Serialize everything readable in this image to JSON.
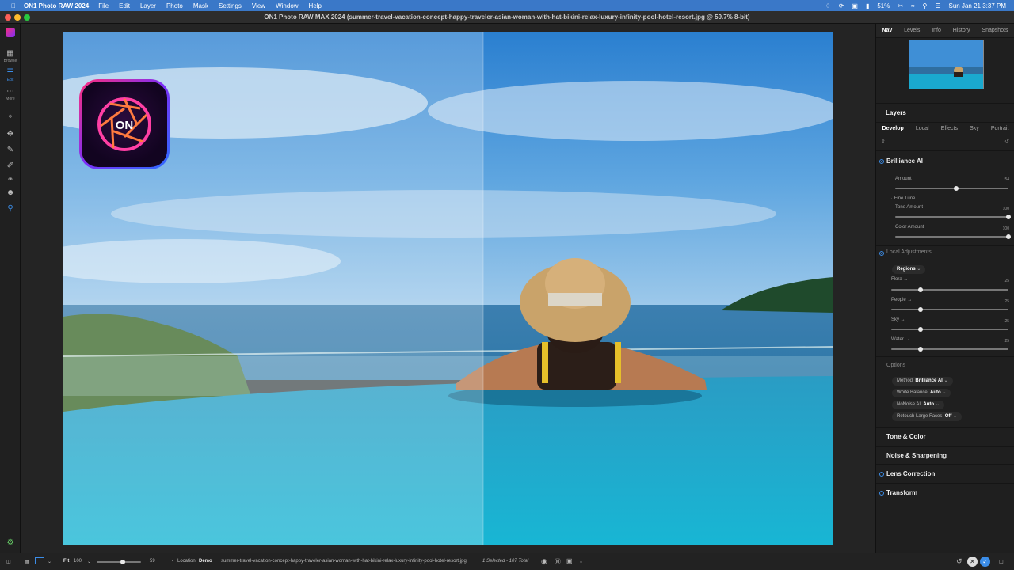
{
  "menubar": {
    "app_name": "ON1 Photo RAW 2024",
    "items": [
      "File",
      "Edit",
      "Layer",
      "Photo",
      "Mask",
      "Settings",
      "View",
      "Window",
      "Help"
    ],
    "battery": "51%",
    "datetime": "Sun Jan 21  3:37 PM"
  },
  "window": {
    "title": "ON1 Photo RAW MAX 2024 (summer-travel-vacation-concept-happy-traveler-asian-woman-with-hat-bikini-relax-luxury-infinity-pool-hotel-resort.jpg @ 59.7% 8-bit)"
  },
  "left_tools": {
    "browse_label": "Browse",
    "edit_label": "Edit",
    "more_label": "More"
  },
  "right_panel": {
    "tabs": [
      "Nav",
      "Levels",
      "Info",
      "History",
      "Snapshots"
    ],
    "active_tab": "Nav",
    "layers_title": "Layers",
    "module_tabs": [
      "Develop",
      "Local",
      "Effects",
      "Sky",
      "Portrait"
    ],
    "active_module": "Develop",
    "brilliance": {
      "title": "Brilliance AI",
      "amount_label": "Amount",
      "amount_value": "54",
      "amount": 54,
      "fine_tune_label": "Fine Tune",
      "tone_label": "Tone Amount",
      "tone_value": "100",
      "tone": 100,
      "color_label": "Color Amount",
      "color_value": "100",
      "color": 100
    },
    "local": {
      "title": "Local Adjustments",
      "regions_label": "Regions",
      "sliders": [
        {
          "label": "Flora",
          "value": "25",
          "level": 25
        },
        {
          "label": "People",
          "value": "25",
          "level": 25
        },
        {
          "label": "Sky",
          "value": "25",
          "level": 25
        },
        {
          "label": "Water",
          "value": "25",
          "level": 25
        }
      ]
    },
    "options": {
      "title": "Options",
      "method_label": "Method",
      "method_value": "Brilliance AI",
      "wb_label": "White Balance",
      "wb_value": "Auto",
      "nonoise_label": "NoNoise AI",
      "nonoise_value": "Auto",
      "retouch_label": "Retouch Large Faces",
      "retouch_value": "Off"
    },
    "sections": [
      "Tone & Color",
      "Noise & Sharpening",
      "Lens Correction",
      "Transform"
    ]
  },
  "bottom": {
    "fit_label": "Fit",
    "zoom_value": "100",
    "slider_value": "59",
    "location_label": "Location",
    "location_value": "Demo",
    "filename": "summer-travel-vacation-concept-happy-traveler-asian-woman-with-hat-bikini-relax-luxury-infinity-pool-hotel-resort.jpg",
    "selection": "1 Selected - 107 Total"
  },
  "colors": {
    "accent": "#3b8de8",
    "menubar": "#3a78c8"
  },
  "icons": {
    "logo": "on1-aperture-logo"
  }
}
